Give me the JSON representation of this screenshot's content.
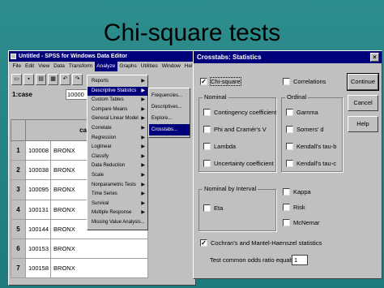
{
  "slide_title": "Chi-square tests",
  "spss": {
    "window_title": "Untitled - SPSS for Windows Data Editor",
    "menu": [
      "File",
      "Edit",
      "View",
      "Data",
      "Transform",
      "Analyze",
      "Graphs",
      "Utilities",
      "Window",
      "Help"
    ],
    "toolbar_icons": [
      "open-icon",
      "save-icon",
      "print-icon",
      "dialog-recall-icon",
      "undo-icon",
      "redo-icon"
    ],
    "cell_ref": "1:case",
    "cell_value": "10000",
    "grid": {
      "header": "case",
      "rows": [
        {
          "n": "1",
          "case": "100008",
          "city": "BRONX"
        },
        {
          "n": "2",
          "case": "100038",
          "city": "BRONX"
        },
        {
          "n": "3",
          "case": "100095",
          "city": "BRONX"
        },
        {
          "n": "4",
          "case": "100131",
          "city": "BRONX"
        },
        {
          "n": "5",
          "case": "100144",
          "city": "BRONX"
        },
        {
          "n": "6",
          "case": "100153",
          "city": "BRONX"
        },
        {
          "n": "7",
          "case": "100158",
          "city": "BRONX"
        }
      ]
    },
    "analyze_menu": [
      {
        "label": "Reports"
      },
      {
        "label": "Descriptive Statistics",
        "highlight": true
      },
      {
        "label": "Custom Tables"
      },
      {
        "label": "Compare Means"
      },
      {
        "label": "General Linear Model"
      },
      {
        "label": "Correlate"
      },
      {
        "label": "Regression"
      },
      {
        "label": "Loglinear"
      },
      {
        "label": "Classify"
      },
      {
        "label": "Data Reduction"
      },
      {
        "label": "Scale"
      },
      {
        "label": "Nonparametric Tests"
      },
      {
        "label": "Time Series"
      },
      {
        "label": "Survival"
      },
      {
        "label": "Multiple Response"
      },
      {
        "label": "Missing Value Analysis..."
      }
    ],
    "descriptive_submenu": [
      {
        "label": "Frequencies..."
      },
      {
        "label": "Descriptives..."
      },
      {
        "label": "Explore..."
      },
      {
        "label": "Crosstabs...",
        "highlight": true
      }
    ]
  },
  "dialog": {
    "title": "Crosstabs: Statistics",
    "close": "×",
    "chi_square": "Chi-square",
    "correlations": "Correlations",
    "nominal": {
      "label": "Nominal",
      "items": [
        "Contingency coefficient",
        "Phi and Cramér's V",
        "Lambda",
        "Uncertainty coefficient"
      ]
    },
    "ordinal": {
      "label": "Ordinal",
      "items": [
        "Gamma",
        "Somers' d",
        "Kendall's tau-b",
        "Kendall's tau-c"
      ]
    },
    "nominal_by_interval": {
      "label": "Nominal by Interval",
      "items": [
        "Eta"
      ]
    },
    "others": [
      "Kappa",
      "Risk",
      "McNemar"
    ],
    "cochrans": "Cochran's and Mantel-Haenszel statistics",
    "odds_label": "Test common odds ratio equals:",
    "odds_value": "1",
    "buttons": {
      "continue": "Continue",
      "cancel": "Cancel",
      "help": "Help"
    },
    "checked_mark": "✓"
  }
}
